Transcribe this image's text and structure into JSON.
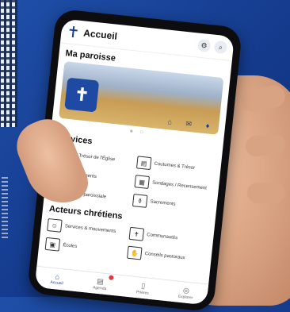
{
  "app": {
    "title": "Accueil"
  },
  "parish": {
    "section_title": "Ma paroisse"
  },
  "services": {
    "section_title": "Services",
    "items": [
      {
        "label": "Le Trésor de l'Église",
        "icon": "book-icon"
      },
      {
        "label": "Coutumes & Trésor",
        "icon": "scroll-icon"
      },
      {
        "label": "Événements",
        "icon": "warning-icon"
      },
      {
        "label": "Sondages / Recensement",
        "icon": "document-icon"
      },
      {
        "label": "Feuille paroissiale",
        "icon": "newspaper-icon"
      },
      {
        "label": "Sacrements",
        "icon": "bottle-icon"
      }
    ]
  },
  "actors": {
    "section_title": "Acteurs chrétiens",
    "items": [
      {
        "label": "Services & mouvements",
        "icon": "group-icon"
      },
      {
        "label": "Communautés",
        "icon": "church-icon"
      },
      {
        "label": "Écoles",
        "icon": "school-icon"
      },
      {
        "label": "Conseils pastoraux",
        "icon": "hands-icon"
      }
    ]
  },
  "tabs": [
    {
      "label": "Accueil",
      "icon": "home-icon",
      "active": true
    },
    {
      "label": "Agenda",
      "icon": "calendar-icon",
      "badge": true
    },
    {
      "label": "Prières",
      "icon": "prayer-icon"
    },
    {
      "label": "Explorer",
      "icon": "compass-icon"
    }
  ]
}
